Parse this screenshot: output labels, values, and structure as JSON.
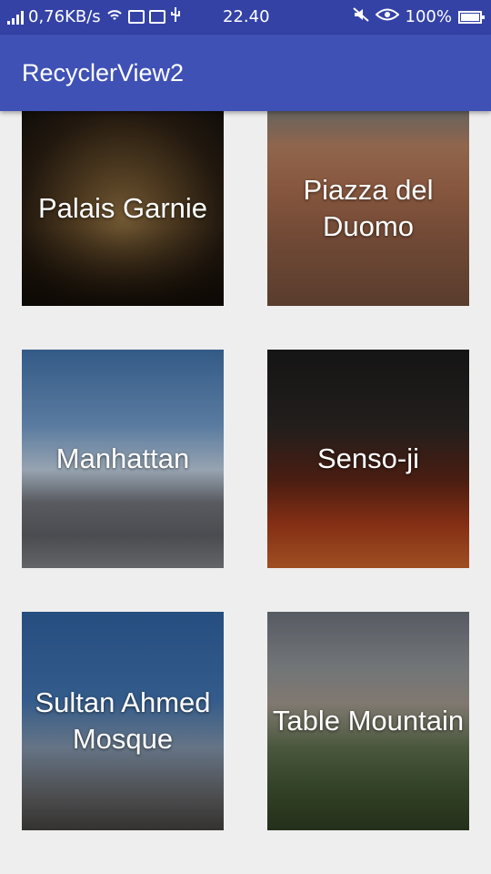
{
  "status_bar": {
    "network_speed": "0,76KB/s",
    "time": "22.40",
    "battery": "100%"
  },
  "app_bar": {
    "title": "RecyclerView2"
  },
  "places": [
    {
      "name": "Palais Garnie"
    },
    {
      "name": "Piazza del Duomo"
    },
    {
      "name": "Manhattan"
    },
    {
      "name": "Senso-ji"
    },
    {
      "name": "Sultan Ahmed Mosque"
    },
    {
      "name": "Table Mountain"
    }
  ]
}
